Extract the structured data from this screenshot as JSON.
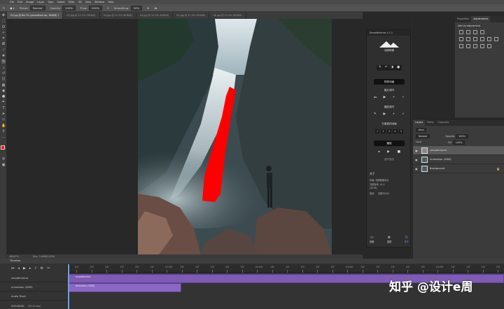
{
  "menubar": {
    "items": [
      "File",
      "Edit",
      "Image",
      "Layer",
      "Type",
      "Select",
      "Filter",
      "3D",
      "View",
      "Window",
      "Help"
    ]
  },
  "optbar": {
    "preset_label": "Preset:",
    "preset_value": "Normal",
    "opacity_label": "Opacity:",
    "opacity_value": "100%",
    "flow_label": "Flow:",
    "flow_value": "100%",
    "smoothing_label": "Smoothing:",
    "smoothing_value": "10%"
  },
  "tabs": [
    "01.jpg @ 66.7% (smoothmirror, RGB/8) *",
    "02.jpg @ 12.5% (RGB/8)",
    "03.jpg @ 12.5% (RGB/8)",
    "04.jpg @ 12.5% (RGB/8)",
    "05.jpg @ 12.5% (RGB/8)",
    "06.jpg @ 12.5% (RGB/8)"
  ],
  "statusbar": {
    "zoom": "66.67%",
    "doc": "Doc: 2.64M/2.82M"
  },
  "timeline": {
    "title": "Timeline",
    "tracks": [
      "smoothmirror",
      "Animation (VDM)",
      "Audio Track"
    ],
    "clips": [
      "smoothmirror",
      "Animation (VDM)"
    ],
    "ticks": [
      "01f",
      "05f",
      "10f",
      "15f",
      "20f",
      "25f",
      "01:00f",
      "05f",
      "10f",
      "15f",
      "20f",
      "25f",
      "02:00f",
      "05f",
      "10f",
      "15f",
      "20f",
      "25f",
      "03:00f",
      "05f",
      "10f",
      "15f",
      "20f",
      "25f",
      "04:00f",
      "05f",
      "10f",
      "15f",
      "20f"
    ],
    "timecode": "0:00:00:00",
    "fps": "(30.00 fps)"
  },
  "plugin": {
    "title": "Smoothmirror v 1.1",
    "logo_text": "动感映像",
    "mode_label": "特效动画",
    "reverse_label": "图片调节",
    "forward_label": "图层调节",
    "preset_label": "匀速直线动画",
    "frames": [
      "1",
      "2",
      "3",
      "4",
      "5"
    ],
    "render_label": "播放",
    "loop_label": "循环播放",
    "about_title": "关于",
    "about_lines": [
      "作者: 动感映像设计",
      "当前版本: v1.1",
      "(2018)"
    ],
    "update_label": "检测",
    "trial_label": "试用中(V2)",
    "bottom": [
      "说明",
      "选项",
      "关于"
    ]
  },
  "adjustments": {
    "tabs": [
      "Properties",
      "Adjustments"
    ],
    "add_label": "Add an adjustment"
  },
  "layers": {
    "tabs": [
      "Layers",
      "Paths",
      "Channels"
    ],
    "kind": "Kind",
    "blend": "Normal",
    "opacity_label": "Opacity:",
    "opacity_value": "100%",
    "lock_label": "Lock:",
    "fill_label": "Fill:",
    "fill_value": "100%",
    "rows": [
      {
        "name": "smoothmirror"
      },
      {
        "name": "Animation (VDM)"
      },
      {
        "name": "Background"
      }
    ]
  },
  "watermark": "知乎 @设计e周",
  "colors": {
    "stroke": "#ff0000",
    "clip": "#7e5bb5",
    "accent": "#69a0e8"
  }
}
